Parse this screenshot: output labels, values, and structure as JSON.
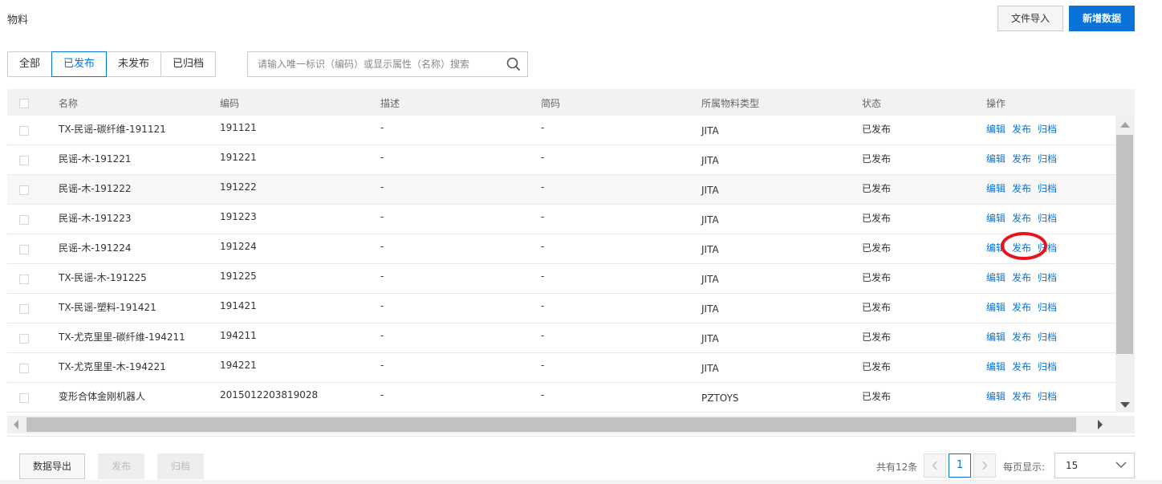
{
  "page": {
    "title": "物料"
  },
  "header": {
    "import_label": "文件导入",
    "new_label": "新增数据"
  },
  "tabs": [
    {
      "label": "全部",
      "active": false
    },
    {
      "label": "已发布",
      "active": true
    },
    {
      "label": "未发布",
      "active": false
    },
    {
      "label": "已归档",
      "active": false
    }
  ],
  "search": {
    "placeholder": "请输入唯一标识（编码）或显示属性（名称）搜索",
    "value": ""
  },
  "table": {
    "columns": [
      "名称",
      "编码",
      "描述",
      "简码",
      "所属物料类型",
      "状态",
      "操作"
    ],
    "rows": [
      {
        "name": "TX-民谣-碳纤维-191121",
        "code": "191121",
        "desc": "-",
        "short": "-",
        "type": "JITA",
        "status": "已发布"
      },
      {
        "name": "民谣-木-191221",
        "code": "191221",
        "desc": "-",
        "short": "-",
        "type": "JITA",
        "status": "已发布"
      },
      {
        "name": "民谣-木-191222",
        "code": "191222",
        "desc": "-",
        "short": "-",
        "type": "JITA",
        "status": "已发布"
      },
      {
        "name": "民谣-木-191223",
        "code": "191223",
        "desc": "-",
        "short": "-",
        "type": "JITA",
        "status": "已发布"
      },
      {
        "name": "民谣-木-191224",
        "code": "191224",
        "desc": "-",
        "short": "-",
        "type": "JITA",
        "status": "已发布"
      },
      {
        "name": "TX-民谣-木-191225",
        "code": "191225",
        "desc": "-",
        "short": "-",
        "type": "JITA",
        "status": "已发布"
      },
      {
        "name": "TX-民谣-塑料-191421",
        "code": "191421",
        "desc": "-",
        "short": "-",
        "type": "JITA",
        "status": "已发布"
      },
      {
        "name": "TX-尤克里里-碳纤维-194211",
        "code": "194211",
        "desc": "-",
        "short": "-",
        "type": "JITA",
        "status": "已发布"
      },
      {
        "name": "TX-尤克里里-木-194221",
        "code": "194221",
        "desc": "-",
        "short": "-",
        "type": "JITA",
        "status": "已发布"
      },
      {
        "name": "变形合体金刚机器人",
        "code": "2015012203819028",
        "desc": "-",
        "short": "-",
        "type": "PZTOYS",
        "status": "已发布"
      }
    ],
    "actions": {
      "edit": "编辑",
      "publish": "发布",
      "archive": "归档"
    }
  },
  "footer": {
    "export_label": "数据导出",
    "publish_label": "发布",
    "archive_label": "归档",
    "total_text": "共有12条",
    "current_page": "1",
    "per_page_label": "每页显示:",
    "per_page_value": "15"
  },
  "colors": {
    "accent": "#0a73d9",
    "highlight": "#e8141c"
  }
}
